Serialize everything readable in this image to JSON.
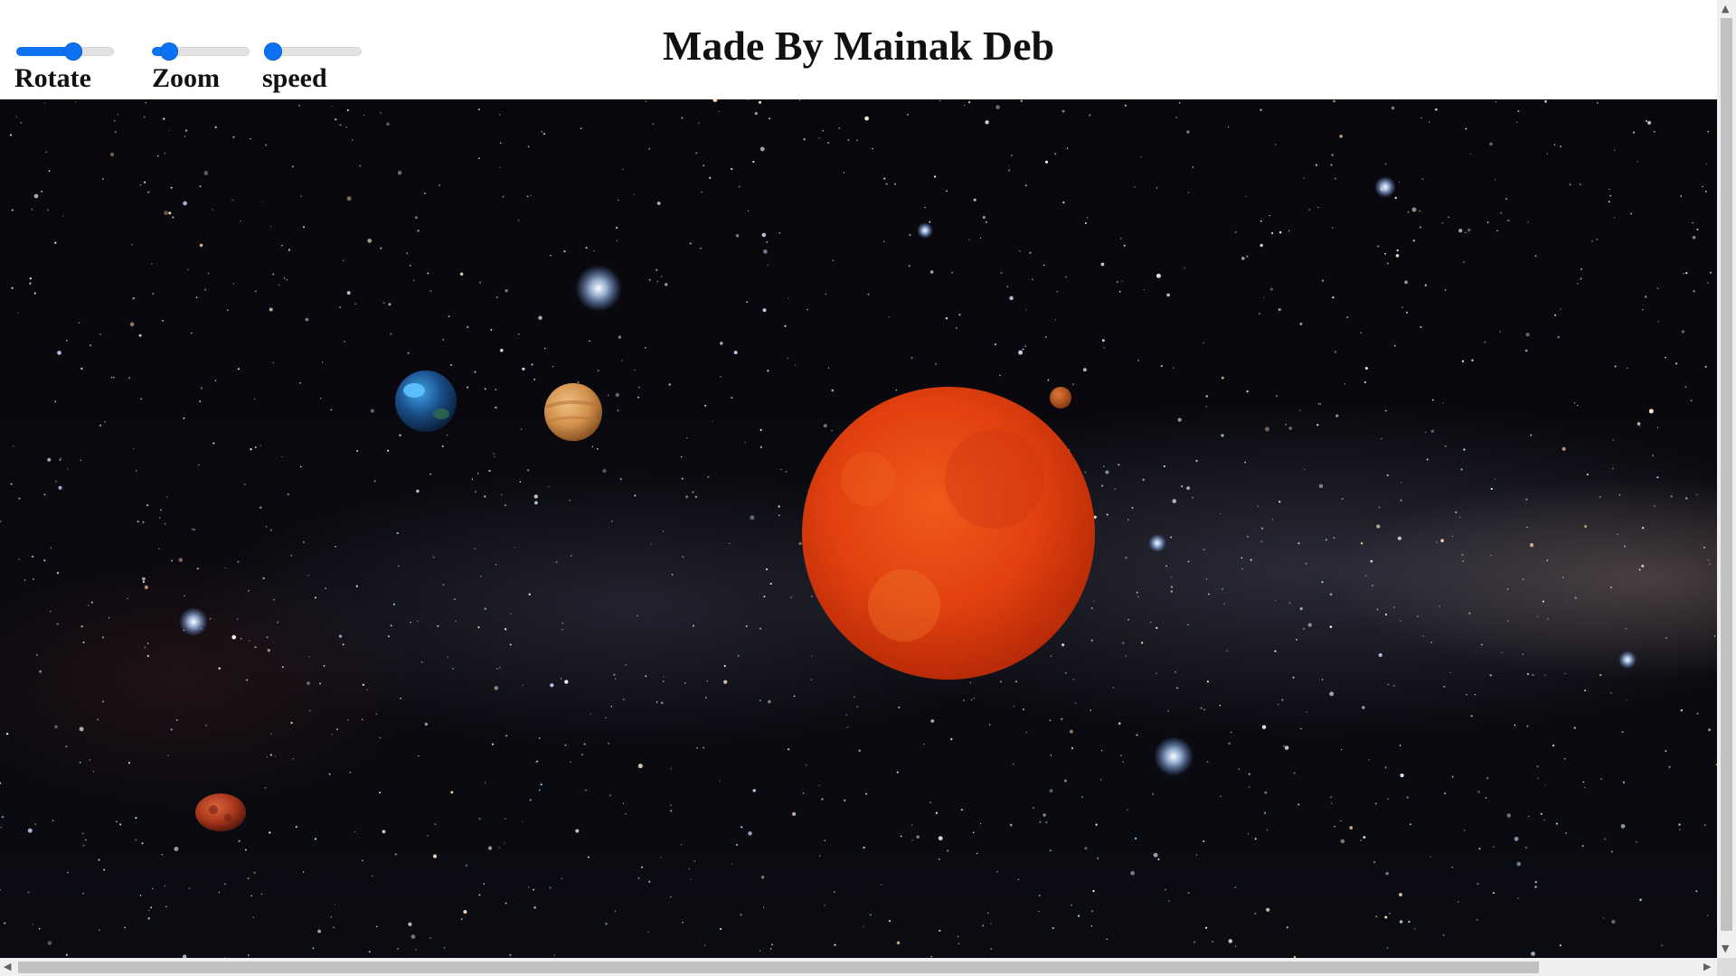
{
  "title": "Made By Mainak Deb",
  "controls": {
    "rotate": {
      "label": "Rotate",
      "value": 0.6
    },
    "zoom": {
      "label": "Zoom",
      "value": 0.1
    },
    "speed": {
      "label": "speed",
      "value": 0.0
    }
  },
  "colors": {
    "accent": "#0d72f2",
    "sun": "#e1400f",
    "space": "#07070c"
  },
  "scene": {
    "bodies": [
      "sun",
      "earth",
      "venus",
      "mars",
      "mercury"
    ]
  },
  "icons": {
    "scroll_left": "◀",
    "scroll_right": "▶",
    "scroll_up": "▲",
    "scroll_down": "▼"
  }
}
